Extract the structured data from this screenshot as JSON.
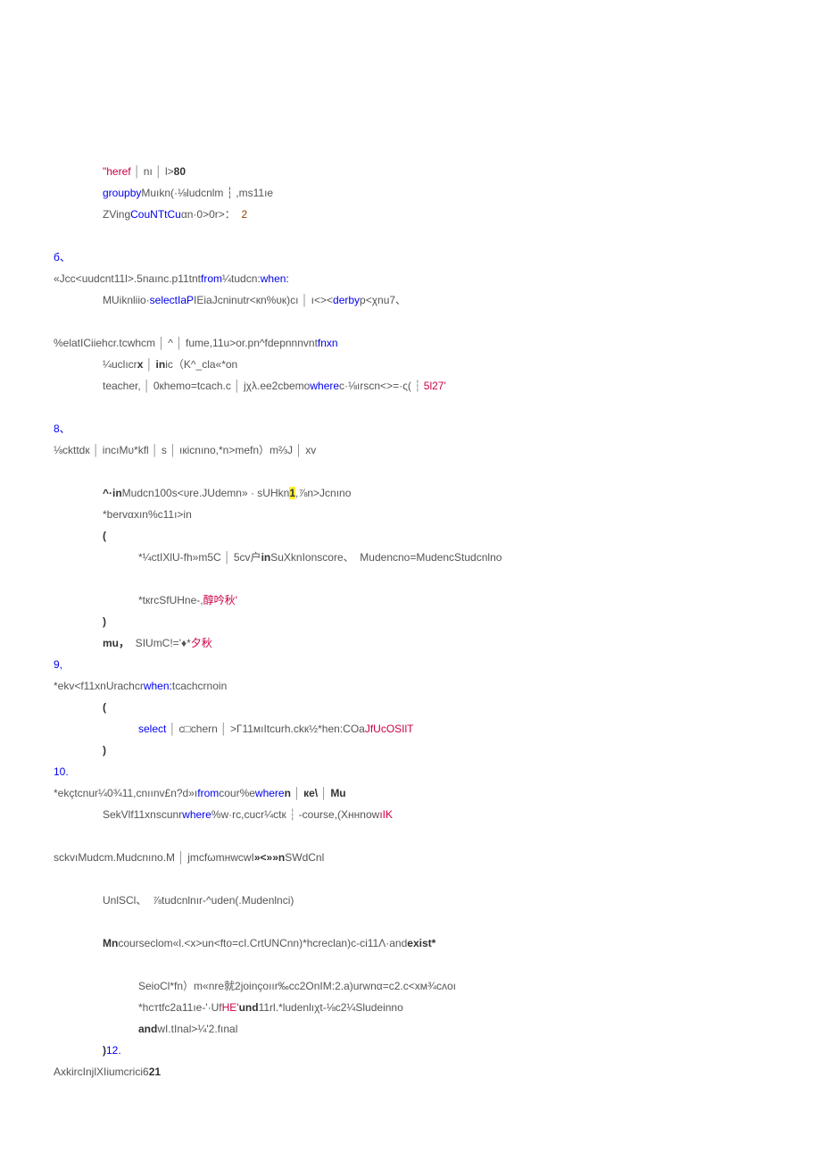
{
  "lines": [
    {
      "cls": "ind1",
      "frags": [
        {
          "t": "\"heref",
          "c": "str"
        },
        {
          "t": " │ ",
          "c": "sym"
        },
        {
          "t": "nı",
          "c": "txt"
        },
        {
          "t": " │ ",
          "c": "sym"
        },
        {
          "t": "l>",
          "c": "txt"
        },
        {
          "t": "80",
          "c": "num bold"
        }
      ]
    },
    {
      "cls": "ind1",
      "frags": [
        {
          "t": "groupby",
          "c": "kw"
        },
        {
          "t": "Muıkn(·⅛ludcnlm ┆ ,ms11ıe",
          "c": "txt"
        }
      ]
    },
    {
      "cls": "ind1",
      "frags": [
        {
          "t": "ZVing",
          "c": "txt"
        },
        {
          "t": "CouNTtCu",
          "c": "kw"
        },
        {
          "t": "αn·0>0r>：",
          "c": "txt"
        },
        {
          "t": "  2",
          "c": "num"
        }
      ]
    },
    {
      "cls": "",
      "frags": [
        {
          "t": " ",
          "c": "txt"
        }
      ]
    },
    {
      "cls": "",
      "frags": [
        {
          "t": "б、",
          "c": "kw"
        }
      ]
    },
    {
      "cls": "",
      "frags": [
        {
          "t": "«Jcc<",
          "c": "txt"
        },
        {
          "t": "uudcnt11l>.5naınc.p11tnt",
          "c": "txt"
        },
        {
          "t": "from",
          "c": "kw"
        },
        {
          "t": "¼tudcn:",
          "c": "txt"
        },
        {
          "t": "when:",
          "c": "kw"
        }
      ]
    },
    {
      "cls": "ind1",
      "frags": [
        {
          "t": "MUiknliio·",
          "c": "txt"
        },
        {
          "t": "selectIaP",
          "c": "kw"
        },
        {
          "t": "IEiaJcninutr<кn%υк)cı",
          "c": "txt"
        },
        {
          "t": " │ ",
          "c": "sym"
        },
        {
          "t": "ı<><",
          "c": "txt"
        },
        {
          "t": "derby",
          "c": "kw"
        },
        {
          "t": "p<χnu7、",
          "c": "txt"
        }
      ]
    },
    {
      "cls": "",
      "frags": [
        {
          "t": " ",
          "c": "txt"
        }
      ]
    },
    {
      "cls": "",
      "frags": [
        {
          "t": "%elat",
          "c": "txt"
        },
        {
          "t": "ICiiehcr.tcwhcm",
          "c": "txt"
        },
        {
          "t": " │ ",
          "c": "sym"
        },
        {
          "t": "^",
          "c": "txt"
        },
        {
          "t": " │ ",
          "c": "sym"
        },
        {
          "t": "fume,11u>or.pn^fdepnnnvnt",
          "c": "txt"
        },
        {
          "t": "fnxn",
          "c": "kw"
        }
      ]
    },
    {
      "cls": "ind1",
      "frags": [
        {
          "t": "¼uclıcr",
          "c": "txt"
        },
        {
          "t": "x",
          "c": "bold"
        },
        {
          "t": " │ ",
          "c": "sym"
        },
        {
          "t": "in",
          "c": "kw bold"
        },
        {
          "t": "ic（K^_cla«*on",
          "c": "txt"
        }
      ]
    },
    {
      "cls": "ind1",
      "frags": [
        {
          "t": "teacher,",
          "c": "txt"
        },
        {
          "t": " │ ",
          "c": "sym"
        },
        {
          "t": "0кhemo=tcach.c",
          "c": "txt"
        },
        {
          "t": " │ ",
          "c": "sym"
        },
        {
          "t": "jχλ.ee2cbemo",
          "c": "txt"
        },
        {
          "t": "where",
          "c": "kw"
        },
        {
          "t": "c·⅛ırscn<>=·ς(",
          "c": "txt"
        },
        {
          "t": " ┆ ",
          "c": "sym"
        },
        {
          "t": "5l27'",
          "c": "str"
        }
      ]
    },
    {
      "cls": "",
      "frags": [
        {
          "t": " ",
          "c": "txt"
        }
      ]
    },
    {
      "cls": "",
      "frags": [
        {
          "t": "8、",
          "c": "kw"
        }
      ]
    },
    {
      "cls": "",
      "frags": [
        {
          "t": "⅛ckttdк",
          "c": "txt"
        },
        {
          "t": " │ ",
          "c": "sym"
        },
        {
          "t": "incı",
          "c": "txt"
        },
        {
          "t": "Mυ*kfl",
          "c": "txt"
        },
        {
          "t": " │ ",
          "c": "sym"
        },
        {
          "t": "s",
          "c": "txt"
        },
        {
          "t": " │ ",
          "c": "sym"
        },
        {
          "t": "ıкicnıno,*n>mefn）m⅔J",
          "c": "txt"
        },
        {
          "t": " │ ",
          "c": "sym"
        },
        {
          "t": "xv",
          "c": "txt"
        }
      ]
    },
    {
      "cls": "",
      "frags": [
        {
          "t": " ",
          "c": "txt"
        }
      ]
    },
    {
      "cls": "ind1",
      "frags": [
        {
          "t": "^·in",
          "c": "bold"
        },
        {
          "t": "Mudcn100s<υre.JUdemn» · sUHkn",
          "c": "txt"
        },
        {
          "t": "1",
          "c": "hl bold"
        },
        {
          "t": ",⅞n>Jcnıno",
          "c": "txt"
        }
      ]
    },
    {
      "cls": "ind1",
      "frags": [
        {
          "t": "*berv",
          "c": "txt"
        },
        {
          "t": "αxın%c11ı>in",
          "c": "txt"
        }
      ]
    },
    {
      "cls": "ind1",
      "frags": [
        {
          "t": "(",
          "c": "bold"
        }
      ]
    },
    {
      "cls": "ind2",
      "frags": [
        {
          "t": "*¼ctIXlU-fh»m5C",
          "c": "txt"
        },
        {
          "t": " │ ",
          "c": "sym"
        },
        {
          "t": "5cv户",
          "c": "txt"
        },
        {
          "t": "in",
          "c": "kw bold"
        },
        {
          "t": "SuXknIon",
          "c": "txt"
        },
        {
          "t": "score、",
          "c": "txt"
        },
        {
          "t": "  Mudencno=MudencStudcnlno",
          "c": "txt"
        }
      ]
    },
    {
      "cls": "",
      "frags": [
        {
          "t": " ",
          "c": "txt"
        }
      ]
    },
    {
      "cls": "ind2",
      "frags": [
        {
          "t": "*tкrc",
          "c": "txt"
        },
        {
          "t": "SfUHne-,",
          "c": "txt"
        },
        {
          "t": "醇吟秋'",
          "c": "str"
        }
      ]
    },
    {
      "cls": "ind1",
      "frags": [
        {
          "t": ")",
          "c": "bold"
        }
      ]
    },
    {
      "cls": "ind1",
      "frags": [
        {
          "t": "mu，",
          "c": "bold"
        },
        {
          "t": "  SIUmC!='♦*",
          "c": "txt"
        },
        {
          "t": "夕秋",
          "c": "str"
        }
      ]
    },
    {
      "cls": "",
      "frags": [
        {
          "t": "9,",
          "c": "kw"
        }
      ]
    },
    {
      "cls": "",
      "frags": [
        {
          "t": "*ekv<f11xn",
          "c": "txt"
        },
        {
          "t": "Urachcr",
          "c": "txt"
        },
        {
          "t": "when:",
          "c": "kw"
        },
        {
          "t": "tcachcrnoin",
          "c": "txt"
        }
      ]
    },
    {
      "cls": "ind1",
      "frags": [
        {
          "t": "(",
          "c": "bold"
        }
      ]
    },
    {
      "cls": "ind2",
      "frags": [
        {
          "t": "select",
          "c": "kw"
        },
        {
          "t": " │ ",
          "c": "sym"
        },
        {
          "t": "c□chern",
          "c": "txt"
        },
        {
          "t": " │ ",
          "c": "sym"
        },
        {
          "t": ">Г11мıItcurh.ckк½*",
          "c": "txt"
        },
        {
          "t": "hen:",
          "c": "txt"
        },
        {
          "t": "COa",
          "c": "txt"
        },
        {
          "t": "JfUcOSIlT",
          "c": "str"
        }
      ]
    },
    {
      "cls": "ind1",
      "frags": [
        {
          "t": ")",
          "c": "bold"
        }
      ]
    },
    {
      "cls": "",
      "frags": [
        {
          "t": "10.",
          "c": "kw"
        }
      ]
    },
    {
      "cls": "",
      "frags": [
        {
          "t": "*ekçtcnur¼0¾11,cnıınv£n?d»ı",
          "c": "txt"
        },
        {
          "t": "from",
          "c": "kw"
        },
        {
          "t": "cour%e",
          "c": "txt"
        },
        {
          "t": "where",
          "c": "kw"
        },
        {
          "t": "n",
          "c": "bold"
        },
        {
          "t": " │ ",
          "c": "sym"
        },
        {
          "t": "ке\\",
          "c": "bold"
        },
        {
          "t": " │ ",
          "c": "sym"
        },
        {
          "t": "Mu",
          "c": "bold"
        }
      ]
    },
    {
      "cls": "ind1",
      "frags": [
        {
          "t": "SekVlf11xn",
          "c": "txt"
        },
        {
          "t": "scunr",
          "c": "txt"
        },
        {
          "t": "where",
          "c": "kw"
        },
        {
          "t": "%w·rc,cucr¼ctк ",
          "c": "txt"
        },
        {
          "t": "┆",
          "c": "sym"
        },
        {
          "t": " -course,(",
          "c": "txt"
        },
        {
          "t": "Xннnow",
          "c": "txt"
        },
        {
          "t": "ıIK",
          "c": "str"
        }
      ]
    },
    {
      "cls": "",
      "frags": [
        {
          "t": " ",
          "c": "txt"
        }
      ]
    },
    {
      "cls": "",
      "frags": [
        {
          "t": "sckvı",
          "c": "txt"
        },
        {
          "t": "Mudcm.Mudcnıno.M",
          "c": "txt"
        },
        {
          "t": " │ ",
          "c": "sym"
        },
        {
          "t": "jmcfωmнwcwI",
          "c": "txt"
        },
        {
          "t": "»<»»n",
          "c": "bold"
        },
        {
          "t": "SWdCnl",
          "c": "txt"
        }
      ]
    },
    {
      "cls": "",
      "frags": [
        {
          "t": " ",
          "c": "txt"
        }
      ]
    },
    {
      "cls": "ind1",
      "frags": [
        {
          "t": "UnlSCl、",
          "c": "txt"
        },
        {
          "t": "  ⅞tudcnlnır-^uden(.Mudenlnci)",
          "c": "txt"
        }
      ]
    },
    {
      "cls": "",
      "frags": [
        {
          "t": " ",
          "c": "txt"
        }
      ]
    },
    {
      "cls": "ind1",
      "frags": [
        {
          "t": "Mn",
          "c": "bold"
        },
        {
          "t": "courseclom«l.<x>un<fto=cI.CrtUNCnn)*hcreclan)c-ci11Λ·and",
          "c": "txt"
        },
        {
          "t": "exist*",
          "c": "bold"
        }
      ]
    },
    {
      "cls": "",
      "frags": [
        {
          "t": " ",
          "c": "txt"
        }
      ]
    },
    {
      "cls": "ind2",
      "frags": [
        {
          "t": "SeioCl*fn",
          "c": "txt"
        },
        {
          "t": "）m«nre就2joinçoıır‰cc2OnIM:2.a)urwnα=c2.c<xм¾cᴧoı",
          "c": "txt"
        }
      ]
    },
    {
      "cls": "ind2",
      "frags": [
        {
          "t": "*hcтtfc2a11ıe-'·Uf",
          "c": "txt"
        },
        {
          "t": "HE'",
          "c": "str"
        },
        {
          "t": "und",
          "c": "bold"
        },
        {
          "t": "11rl.*ludenlıχt-⅛c2¼Sludeinno",
          "c": "txt"
        }
      ]
    },
    {
      "cls": "ind2",
      "frags": [
        {
          "t": "and",
          "c": "kw bold"
        },
        {
          "t": "wI.tInal>¼'2.fınal",
          "c": "txt"
        }
      ]
    },
    {
      "cls": "ind1",
      "frags": [
        {
          "t": ")",
          "c": "bold"
        },
        {
          "t": "12.",
          "c": "kw"
        }
      ]
    },
    {
      "cls": "",
      "frags": [
        {
          "t": "AxkircInjlXIiumcrici6",
          "c": "txt"
        },
        {
          "t": "21",
          "c": "bold"
        }
      ]
    }
  ]
}
